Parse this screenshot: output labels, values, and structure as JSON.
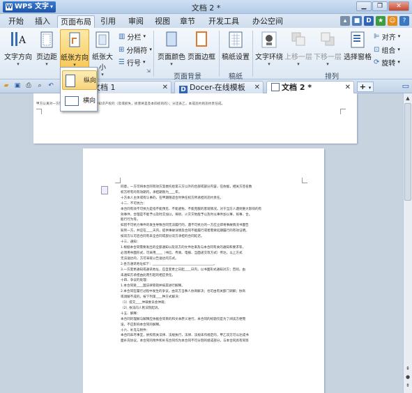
{
  "app": {
    "name": "WPS 文字",
    "doc_title": "文档 2 *"
  },
  "menu": {
    "tabs": [
      "开始",
      "插入",
      "页面布局",
      "引用",
      "审阅",
      "视图",
      "章节",
      "开发工具",
      "办公空间"
    ],
    "active": "页面布局"
  },
  "ribbon": {
    "text_direction": "文字方向",
    "margins": "页边距",
    "orientation": "纸张方向",
    "size": "纸张大小",
    "columns": "分栏",
    "breaks": "分隔符",
    "line_numbers": "行号",
    "page_color": "页面颜色",
    "page_border": "页面边框",
    "manuscript": "稿纸设置",
    "wrap": "文字环绕",
    "bring_forward": "上移一层",
    "send_backward": "下移一层",
    "selection_pane": "选择窗格",
    "align": "对齐",
    "group": "组合",
    "rotate": "旋转",
    "group_page_bg": "页面背景",
    "group_manuscript": "稿纸",
    "group_arrange": "排列"
  },
  "doc_tabs": [
    {
      "label": "文档 1",
      "active": false
    },
    {
      "label": "Docer-在线模板",
      "active": false
    },
    {
      "label": "文档 2 *",
      "active": true
    }
  ],
  "orientation_menu": {
    "portrait": "纵向",
    "landscape": "横向"
  },
  "page1": {
    "text": "甲方认真对一方勤劳是因为合法开发的软件知识产权的（及或损失，损害将是及本四权的的）；分还表乙，本成违约则违约责任成。"
  },
  "page2": {
    "lines": [
      "同意，一方可将本合同有效方案委托给第三方以外的合部或部分内容，在依据，相关方签名数",
      "权方所有的有效期内，承担期限为____年。",
      "十方本人主体或有认事的，在甲期限适合时供任权方所承担的违约责任。",
      "十二、不可抗力：",
      "本合同有效不可抗力是指不能预见、不能避免、不能克服的客观情况。对于当方人遇到重大影响的有",
      "效事件，合理是不能予以及时实加以，将损、火灾灾地能予以及时以事件加以事，如事、合。",
      "能行行为等。",
      "如因不可抗力事件的发生导致合同无法履行的，遇不可抗力的一方应立即将事故情况书面告",
      "知另一方，并应在____天内，提供事故详情及合同不能履行或者需要延期履行的有效证明。",
      "按双方认可后合同有未全合同或部分双方承担的合同延迟。",
      "十三、通知：",
      "1.根据本合同需要发出的全部通知以及双方的文件往来及与本合同有关的通知和要求等，",
      "必须用书面形式，可采用____（书信、传真、电报、当面递交等方式）传达。以上方式",
      "无法送达的，方可采取公告送达的方式。",
      "2.各方通讯地址如下：______________________________________。",
      "3.一方变更通知或通讯地址，应自变更之日起____日内，以书面形式通知对方；否则，由",
      "未通知方承担由此而引起的相应责任。",
      "十四、争议的处理：",
      "1.本合同受____国法律管辖并按其进行解释。",
      "2.本合同在履行过程中发生的争议，由双方当事人协商解决；也可由有关部门调解；协商",
      "或调解不成的，按下列第____种方式解决：",
      "（1）提交____仲裁委员会仲裁；",
      "（2）依法向人民法院起诉。",
      "十五、解释：",
      "本合同的理解与解释应依据合同目的和文本原义进行。本合同的标题仅是为了阅读方便而",
      "设，不应影响本合同的解释。",
      "十六、补充与附件：",
      "本合同未尽事宜，依照有关法律、法规执行，法律、法规未作规定的，甲乙双方可以达成书",
      "面补充协议。本合同的附件和补充合同均为本合同不可分割的组成部分，与本合同具有同等"
    ]
  }
}
